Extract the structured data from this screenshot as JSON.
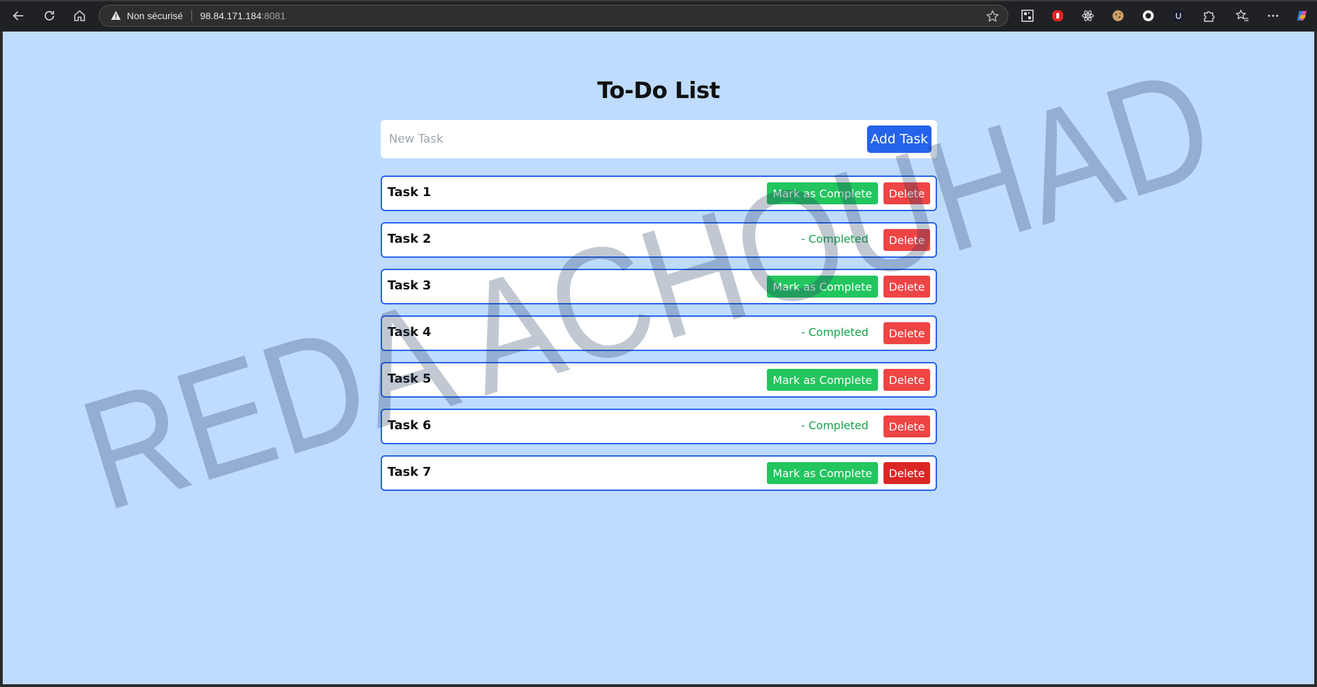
{
  "browser": {
    "security_label": "Non sécurisé",
    "url_host": "98.84.171.184",
    "url_port": ":8081",
    "extensions": [
      "qr-code-icon",
      "adblock-icon",
      "react-icon",
      "cookie-icon",
      "circle-icon",
      "extension-u-icon",
      "puzzle-icon"
    ]
  },
  "app": {
    "title": "To-Do List",
    "input_placeholder": "New Task",
    "input_value": "",
    "add_button_label": "Add Task",
    "mark_complete_label": "Mark as Complete",
    "delete_label": "Delete",
    "completed_label": "- Completed",
    "tasks": [
      {
        "name": "Task 1",
        "completed": false
      },
      {
        "name": "Task 2",
        "completed": true
      },
      {
        "name": "Task 3",
        "completed": false
      },
      {
        "name": "Task 4",
        "completed": true
      },
      {
        "name": "Task 5",
        "completed": false
      },
      {
        "name": "Task 6",
        "completed": true
      },
      {
        "name": "Task 7",
        "completed": false
      }
    ]
  },
  "watermark": "REDA ACHOUHAD",
  "colors": {
    "page_bg": "#bfdbfe",
    "primary": "#2563eb",
    "success": "#22c55e",
    "danger": "#ef4444",
    "completed_text": "#16a34a"
  }
}
